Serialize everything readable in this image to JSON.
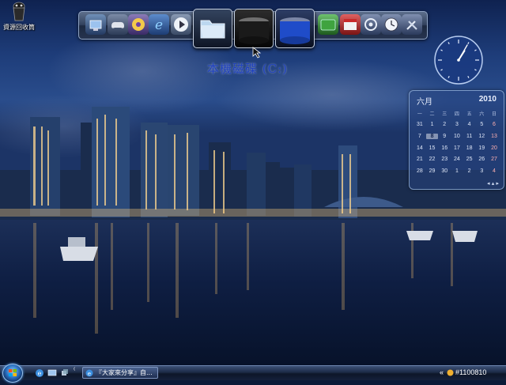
{
  "desktop": {
    "icon_label": "資源回收筒"
  },
  "dock": {
    "drive_label": "本機磁碟 (C:)"
  },
  "clock": {
    "hour": 1,
    "minute": 5
  },
  "calendar": {
    "month": "六月",
    "year": "2010",
    "weekdays": [
      "一",
      "二",
      "三",
      "四",
      "五",
      "六",
      "日"
    ],
    "weeks": [
      [
        "31",
        "1",
        "2",
        "3",
        "4",
        "5",
        "6"
      ],
      [
        "7",
        "8",
        "9",
        "10",
        "11",
        "12",
        "13"
      ],
      [
        "14",
        "15",
        "16",
        "17",
        "18",
        "19",
        "20"
      ],
      [
        "21",
        "22",
        "23",
        "24",
        "25",
        "26",
        "27"
      ],
      [
        "28",
        "29",
        "30",
        "1",
        "2",
        "3",
        "4"
      ]
    ],
    "today": "8"
  },
  "taskbar": {
    "task_label": "『大家來分享』自...",
    "tray_text": "#1100810"
  },
  "colors": {
    "sky": "#142d66",
    "water": "#0a1a3a",
    "accent": "#1d3fbf"
  }
}
